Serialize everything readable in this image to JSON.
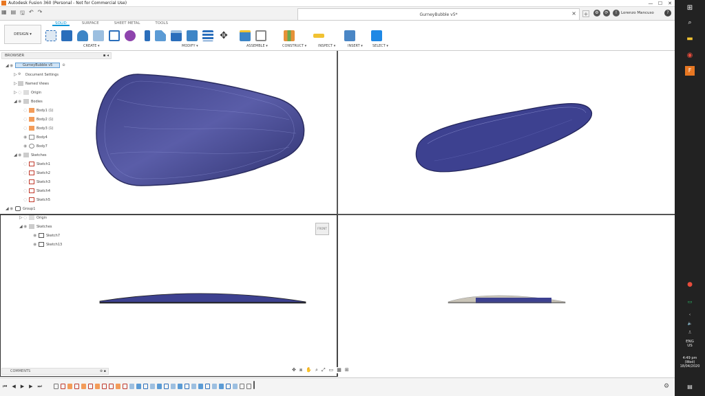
{
  "window": {
    "title": "Autodesk Fusion 360 (Personal - Not for Commercial Use)",
    "controls": [
      "—",
      "☐",
      "✕"
    ]
  },
  "document_tab": {
    "title": "GurneyBubble v5*"
  },
  "user": {
    "name": "Lorenzo Mancuso"
  },
  "workspace": {
    "label": "DESIGN ▾"
  },
  "ribbon_tabs": [
    "SOLID",
    "SURFACE",
    "SHEET METAL",
    "TOOLS"
  ],
  "ribbon_groups": [
    "CREATE ▾",
    "MODIFY ▾",
    "ASSEMBLE ▾",
    "CONSTRUCT ▾",
    "INSPECT ▾",
    "INSERT ▾",
    "SELECT ▾"
  ],
  "browser": {
    "title": "BROWSER",
    "root": "GurneyBubble v5",
    "items": [
      "Document Settings",
      "Named Views",
      "Origin",
      "Bodies",
      "Body1 (1)",
      "Body2 (1)",
      "Body3 (1)",
      "Body4",
      "Body7",
      "Sketches",
      "Sketch1",
      "Sketch2",
      "Sketch3",
      "Sketch4",
      "Sketch5",
      "Group1",
      "Origin",
      "Sketches",
      "Sketch7",
      "Sketch13"
    ]
  },
  "comments": {
    "title": "COMMENTS"
  },
  "viewcube": {
    "label": "FRONT"
  },
  "taskbar": {
    "lang1": "ENG",
    "lang2": "US",
    "time": "4:49 pm",
    "day": "(Wed)",
    "date": "18/04/2020"
  }
}
